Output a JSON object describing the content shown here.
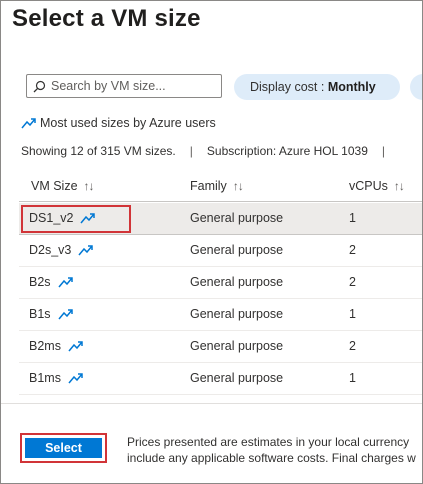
{
  "title": "Select a VM size",
  "search": {
    "placeholder": "Search by VM size...",
    "icon": "search-icon"
  },
  "display_cost": {
    "label": "Display cost : ",
    "value": "Monthly"
  },
  "most_used": {
    "label": "Most used sizes by Azure users",
    "icon": "trending-icon"
  },
  "summary": {
    "showing": "Showing 12 of 315 VM sizes.",
    "separator": "|",
    "subscription": "Subscription: Azure HOL 1039"
  },
  "table": {
    "columns": [
      {
        "label": "VM Size",
        "sort": "↑↓"
      },
      {
        "label": "Family",
        "sort": "↑↓"
      },
      {
        "label": "vCPUs",
        "sort": "↑↓"
      }
    ],
    "rows": [
      {
        "size": "DS1_v2",
        "family": "General purpose",
        "vcpus": "1"
      },
      {
        "size": "D2s_v3",
        "family": "General purpose",
        "vcpus": "2"
      },
      {
        "size": "B2s",
        "family": "General purpose",
        "vcpus": "2"
      },
      {
        "size": "B1s",
        "family": "General purpose",
        "vcpus": "1"
      },
      {
        "size": "B2ms",
        "family": "General purpose",
        "vcpus": "2"
      },
      {
        "size": "B1ms",
        "family": "General purpose",
        "vcpus": "1"
      }
    ],
    "selected_index": 0
  },
  "footer": {
    "select_label": "Select",
    "note_line1": "Prices presented are estimates in your local currency",
    "note_line2": "include any applicable software costs. Final charges w"
  },
  "colors": {
    "accent": "#0078d4",
    "highlight": "#d13438",
    "pill": "#deecf9",
    "selected_row": "#edebe9"
  }
}
